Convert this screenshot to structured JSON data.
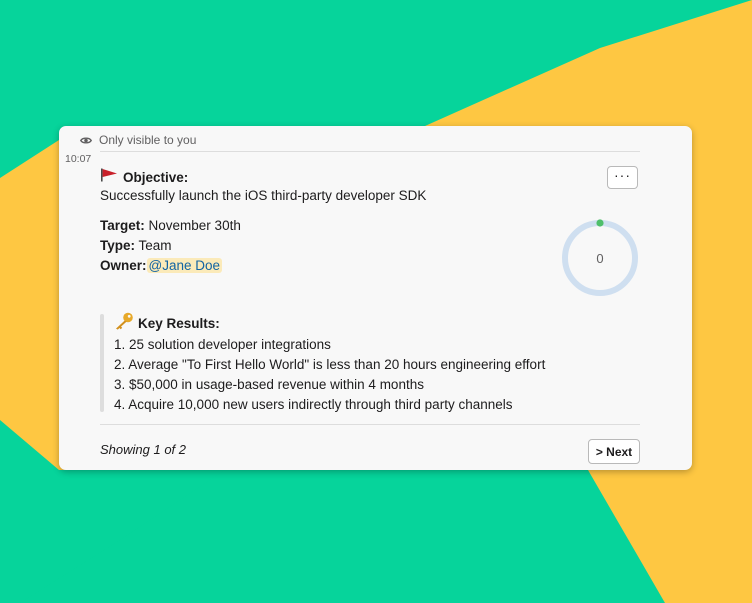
{
  "colors": {
    "background_green": "#06d49b",
    "background_yellow": "#fec742",
    "card": "#f8f8f8",
    "mention_bg": "#fbeab9",
    "mention_text": "#1264a3",
    "ring_track": "#cfdff0",
    "ring_dot": "#4fbf6b",
    "flag": "#c8202a",
    "key": "#e7a92a"
  },
  "message": {
    "visibility_icon": "eye-icon",
    "visibility_text": "Only visible to you",
    "timestamp": "10:07",
    "menu_button_label": "···"
  },
  "objective": {
    "icon": "red-flag-icon",
    "label": "Objective:",
    "text": "Successfully launch the iOS third-party developer SDK"
  },
  "details": {
    "target_label": "Target:",
    "target_value": "November 30th",
    "type_label": "Type:",
    "type_value": "Team",
    "owner_label": "Owner:",
    "owner_value": "@Jane Doe"
  },
  "progress": {
    "display_value": "0",
    "fraction": 0
  },
  "key_results": {
    "icon": "key-icon",
    "label": "Key Results:",
    "items": [
      "1. 25 solution developer integrations",
      "2. Average \"To First Hello World\" is less than 20 hours engineering effort",
      "3. $50,000 in usage-based revenue within 4 months",
      "4. Acquire 10,000 new users indirectly through third party channels"
    ]
  },
  "pagination": {
    "showing_text": "Showing 1 of 2",
    "next_label": "> Next"
  }
}
